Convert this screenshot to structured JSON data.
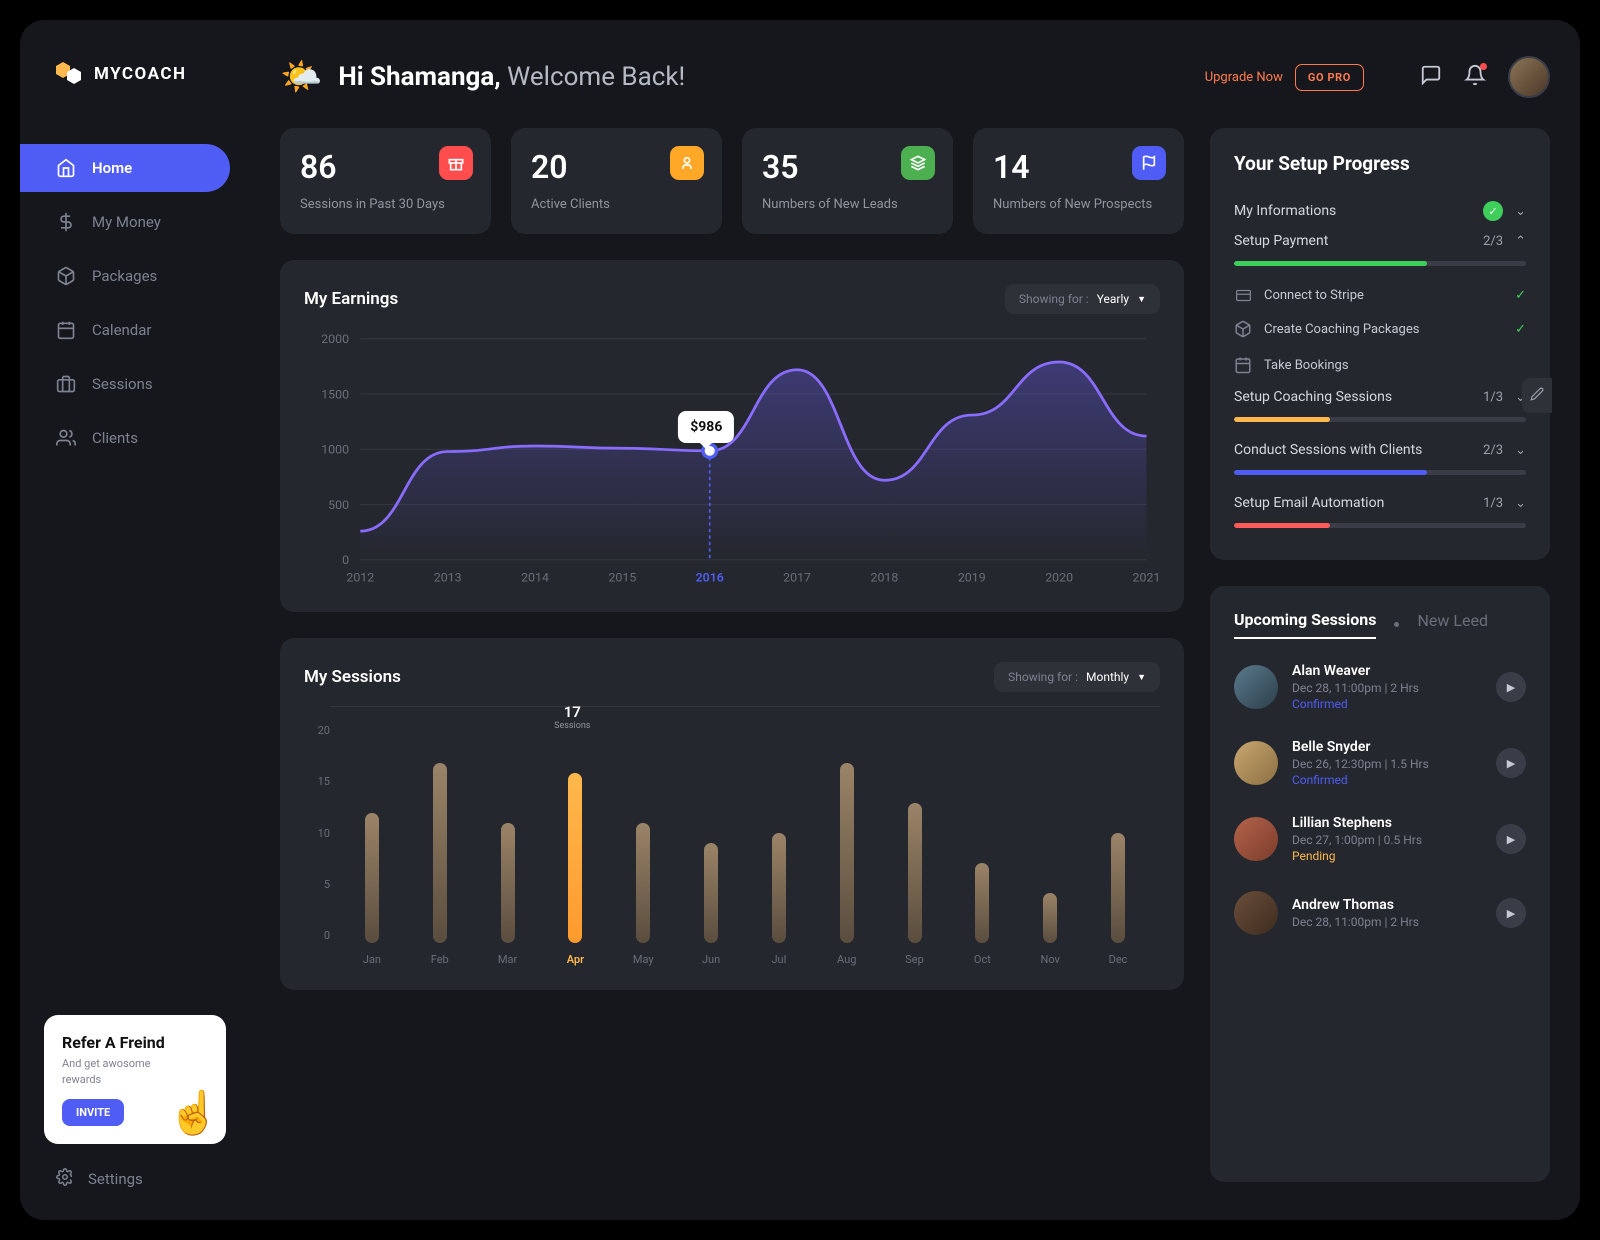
{
  "brand": {
    "name": "MYCOACH"
  },
  "sidebar": {
    "items": [
      {
        "label": "Home",
        "icon": "home-icon"
      },
      {
        "label": "My Money",
        "icon": "dollar-icon"
      },
      {
        "label": "Packages",
        "icon": "box-icon"
      },
      {
        "label": "Calendar",
        "icon": "calendar-icon"
      },
      {
        "label": "Sessions",
        "icon": "briefcase-icon"
      },
      {
        "label": "Clients",
        "icon": "users-icon"
      }
    ],
    "refer": {
      "title": "Refer A Freind",
      "subtitle": "And get awosome rewards",
      "button": "INVITE"
    },
    "settings": "Settings"
  },
  "header": {
    "greeting_prefix": "Hi Shamanga,",
    "greeting_suffix": "Welcome Back!",
    "upgrade_text": "Upgrade Now",
    "gopro": "GO PRO"
  },
  "stats": [
    {
      "value": "86",
      "label": "Sessions in Past 30 Days",
      "badge": "gift-icon",
      "color": "b-red"
    },
    {
      "value": "20",
      "label": "Active Clients",
      "badge": "user-icon",
      "color": "b-orange"
    },
    {
      "value": "35",
      "label": "Numbers of New Leads",
      "badge": "layers-icon",
      "color": "b-green"
    },
    {
      "value": "14",
      "label": "Numbers of New Prospects",
      "badge": "flag-icon",
      "color": "b-blue"
    }
  ],
  "earnings": {
    "title": "My Earnings",
    "showing_for": "Showing for :",
    "period": "Yearly",
    "tooltip": "$986"
  },
  "sessions_chart": {
    "title": "My Sessions",
    "showing_for": "Showing for :",
    "period": "Monthly",
    "callout_value": "17",
    "callout_label": "Sessions"
  },
  "chart_data": [
    {
      "type": "line",
      "title": "My Earnings",
      "ylabel": "",
      "ylim": [
        0,
        2000
      ],
      "yticks": [
        0,
        500,
        1000,
        1500,
        2000
      ],
      "categories": [
        "2012",
        "2013",
        "2014",
        "2015",
        "2016",
        "2017",
        "2018",
        "2019",
        "2020",
        "2021"
      ],
      "values": [
        260,
        980,
        1030,
        1010,
        986,
        1720,
        720,
        1310,
        1790,
        1120
      ],
      "highlight_index": 4,
      "highlight_value": "$986"
    },
    {
      "type": "bar",
      "title": "My Sessions",
      "ylim": [
        0,
        20
      ],
      "yticks": [
        0,
        5,
        10,
        15,
        20
      ],
      "categories": [
        "Jan",
        "Feb",
        "Mar",
        "Apr",
        "May",
        "Jun",
        "Jul",
        "Aug",
        "Sep",
        "Oct",
        "Nov",
        "Dec"
      ],
      "values": [
        13,
        18,
        12,
        17,
        12,
        10,
        11,
        18,
        14,
        8,
        5,
        11
      ],
      "highlight_index": 3
    }
  ],
  "setup": {
    "title": "Your Setup Progress",
    "rows": [
      {
        "label": "My Informations",
        "complete": true
      },
      {
        "label": "Setup Payment",
        "progress": "2/3",
        "expanded": true,
        "fill": 66,
        "color": "pf-green",
        "subtasks": [
          {
            "label": "Connect to Stripe",
            "done": true,
            "icon": "card-icon"
          },
          {
            "label": "Create Coaching Packages",
            "done": true,
            "icon": "box-icon"
          },
          {
            "label": "Take Bookings",
            "done": false,
            "icon": "calendar-icon"
          }
        ]
      },
      {
        "label": "Setup Coaching Sessions",
        "progress": "1/3",
        "fill": 33,
        "color": "pf-orange"
      },
      {
        "label": "Conduct Sessions with Clients",
        "progress": "2/3",
        "fill": 66,
        "color": "pf-blue"
      },
      {
        "label": "Setup Email Automation",
        "progress": "1/3",
        "fill": 33,
        "color": "pf-red"
      }
    ]
  },
  "upcoming": {
    "tab_active": "Upcoming Sessions",
    "tab_other": "New Leed",
    "items": [
      {
        "name": "Alan Weaver",
        "meta": "Dec 28, 11:00pm  |  2 Hrs",
        "status": "Confirmed",
        "status_cls": "st-conf",
        "av": "av1"
      },
      {
        "name": "Belle Snyder",
        "meta": "Dec 26, 12:30pm  |  1.5 Hrs",
        "status": "Confirmed",
        "status_cls": "st-conf",
        "av": "av2"
      },
      {
        "name": "Lillian Stephens",
        "meta": "Dec 27, 1:00pm  |  0.5 Hrs",
        "status": "Pending",
        "status_cls": "st-pend",
        "av": "av3"
      },
      {
        "name": "Andrew Thomas",
        "meta": "Dec 28, 11:00pm  |  2 Hrs",
        "status": "",
        "status_cls": "",
        "av": "av4"
      }
    ]
  }
}
